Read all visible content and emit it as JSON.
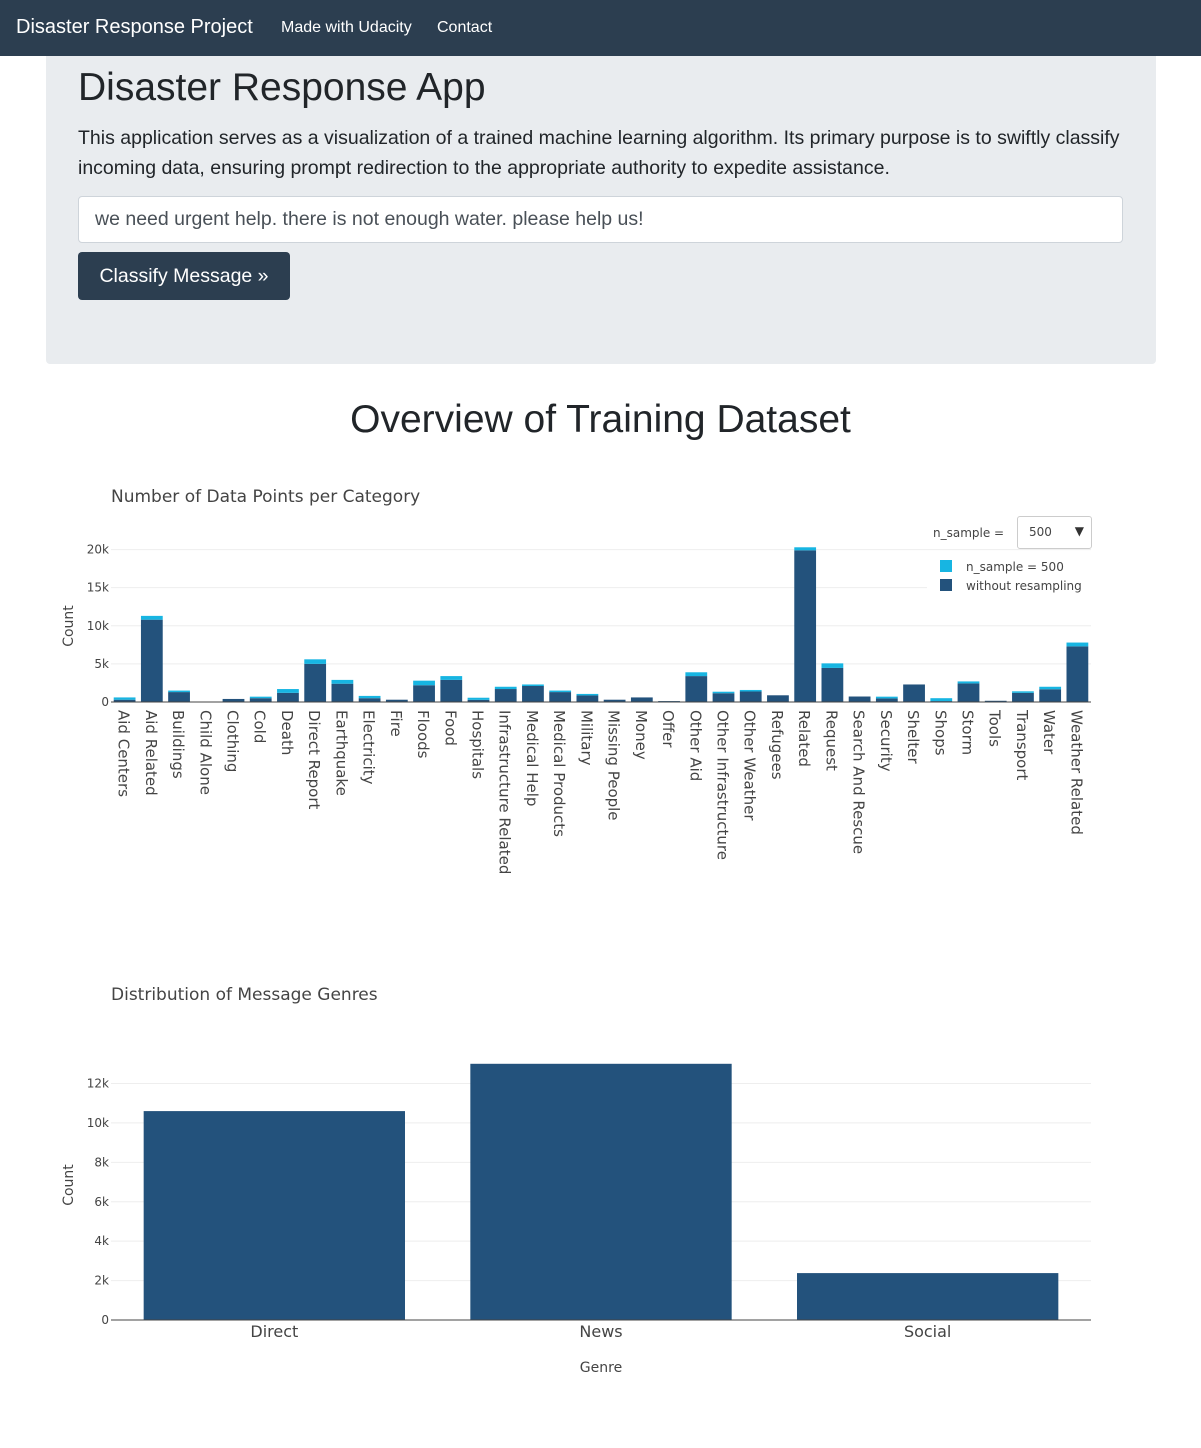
{
  "nav": {
    "brand": "Disaster Response Project",
    "links": [
      "Made with Udacity",
      "Contact"
    ]
  },
  "hero": {
    "title": "Disaster Response App",
    "lead": "This application serves as a visualization of a trained machine learning algorithm. Its primary purpose is to swiftly classify incoming data, ensuring prompt redirection to the appropriate authority to expedite assistance.",
    "message_value": "we need urgent help. there is not enough water. please help us!",
    "button_label": "Classify Message »"
  },
  "section_title": "Overview of Training Dataset",
  "controls": {
    "n_sample_label": "n_sample =",
    "n_sample_value": "500"
  },
  "colors": {
    "navbar": "#2c3e50",
    "jumbotron": "#e9ecef",
    "bar_dark": "#23527c",
    "bar_light": "#17b5e2"
  },
  "chart_data": [
    {
      "type": "bar",
      "stacked": true,
      "title": "Number of Data Points per Category",
      "xlabel": "",
      "ylabel": "Count",
      "ylim": [
        0,
        20600
      ],
      "yticks": [
        0,
        5000,
        10000,
        15000,
        20000
      ],
      "ytick_labels": [
        "0",
        "5k",
        "10k",
        "15k",
        "20k"
      ],
      "grid": true,
      "legend": "top-right",
      "categories": [
        "Aid Centers",
        "Aid Related",
        "Buildings",
        "Child Alone",
        "Clothing",
        "Cold",
        "Death",
        "Direct Report",
        "Earthquake",
        "Electricity",
        "Fire",
        "Floods",
        "Food",
        "Hospitals",
        "Infrastructure Related",
        "Medical Help",
        "Medical Products",
        "Military",
        "Missing People",
        "Money",
        "Offer",
        "Other Aid",
        "Other Infrastructure",
        "Other Weather",
        "Refugees",
        "Related",
        "Request",
        "Search And Rescue",
        "Security",
        "Shelter",
        "Shops",
        "Storm",
        "Tools",
        "Transport",
        "Water",
        "Weather Related"
      ],
      "series": [
        {
          "name": "without resampling",
          "color": "#23527c",
          "values": [
            300,
            10800,
            1300,
            0,
            400,
            500,
            1200,
            5000,
            2400,
            500,
            300,
            2200,
            2900,
            280,
            1700,
            2100,
            1300,
            860,
            300,
            600,
            120,
            3400,
            1150,
            1380,
            880,
            19900,
            4470,
            720,
            470,
            2300,
            120,
            2440,
            160,
            1200,
            1670,
            7300
          ]
        },
        {
          "name": "n_sample = 500",
          "color": "#17b5e2",
          "values": [
            300,
            500,
            200,
            0,
            0,
            200,
            500,
            600,
            500,
            300,
            0,
            600,
            500,
            280,
            300,
            200,
            200,
            200,
            0,
            0,
            0,
            500,
            200,
            200,
            0,
            400,
            600,
            0,
            230,
            0,
            380,
            260,
            0,
            200,
            330,
            500
          ]
        }
      ]
    },
    {
      "type": "bar",
      "title": "Distribution of Message Genres",
      "xlabel": "Genre",
      "ylabel": "Count",
      "ylim": [
        0,
        13700
      ],
      "yticks": [
        0,
        2000,
        4000,
        6000,
        8000,
        10000,
        12000
      ],
      "ytick_labels": [
        "0",
        "2k",
        "4k",
        "6k",
        "8k",
        "10k",
        "12k"
      ],
      "grid": true,
      "categories": [
        "Direct",
        "News",
        "Social"
      ],
      "values": [
        10600,
        13000,
        2380
      ],
      "color": "#23527c"
    }
  ]
}
